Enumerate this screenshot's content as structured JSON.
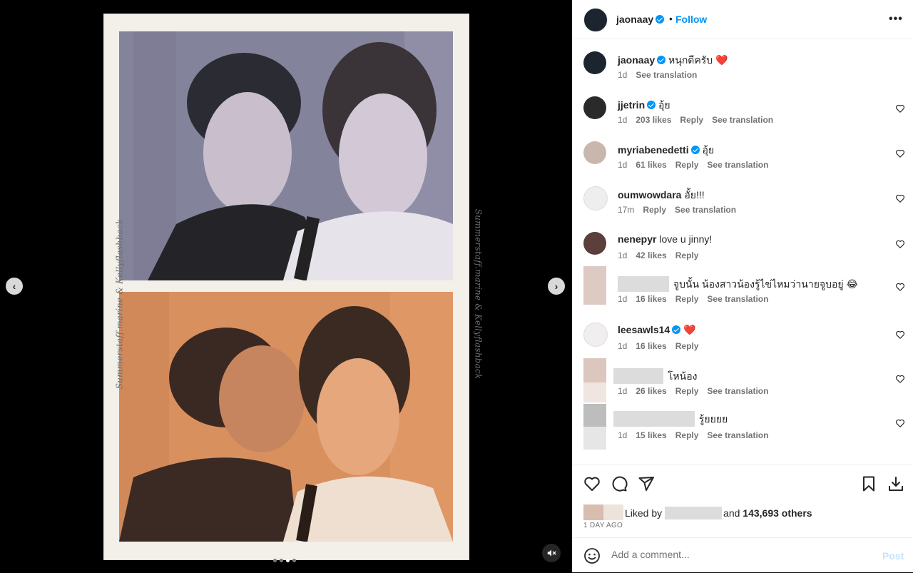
{
  "post": {
    "author": "jaonaay",
    "follow_label": "Follow",
    "separator": "•",
    "more_label": "•••",
    "caption_text": "หนุกดีครับ ❤️",
    "caption_time": "1d",
    "see_translation": "See translation"
  },
  "media": {
    "frame_caption": "Summerstaff.marine & Kellyflashback",
    "carousel_total_dots": 4,
    "carousel_active_dot": 3
  },
  "comments": [
    {
      "username": "jjetrin",
      "verified": true,
      "text": "อุ้ย",
      "time": "1d",
      "likes": "203 likes",
      "reply": "Reply",
      "translate": "See translation"
    },
    {
      "username": "myriabenedetti",
      "verified": true,
      "text": "อุ้ย",
      "time": "1d",
      "likes": "61 likes",
      "reply": "Reply",
      "translate": "See translation"
    },
    {
      "username": "oumwowdara",
      "verified": false,
      "text": "อั้ย!!!",
      "time": "17m",
      "likes": "",
      "reply": "Reply",
      "translate": "See translation"
    },
    {
      "username": "nenepyr",
      "verified": false,
      "text": "love u jinny!",
      "time": "1d",
      "likes": "42 likes",
      "reply": "Reply",
      "translate": ""
    },
    {
      "username": "",
      "verified": false,
      "text": "จูบนั้น น้องสาวน้องรู้ไข่ไหมว่านายจูบอยู่ 😂",
      "time": "1d",
      "likes": "16 likes",
      "reply": "Reply",
      "translate": "See translation"
    },
    {
      "username": "leesawls14",
      "verified": true,
      "text": "❤️",
      "time": "1d",
      "likes": "16 likes",
      "reply": "Reply",
      "translate": ""
    },
    {
      "username": "",
      "verified": false,
      "text": "โหน้อง",
      "time": "1d",
      "likes": "26 likes",
      "reply": "Reply",
      "translate": "See translation"
    },
    {
      "username": "",
      "verified": false,
      "text": "รู้ยยยย",
      "time": "1d",
      "likes": "15 likes",
      "reply": "Reply",
      "translate": "See translation"
    }
  ],
  "actions": {
    "liked_by_prefix": "Liked by",
    "liked_by_and": "and",
    "liked_by_count": "143,693 others",
    "date": "1 DAY AGO"
  },
  "comment_box": {
    "placeholder": "Add a comment...",
    "post_label": "Post"
  },
  "colors": {
    "link_blue": "#0095f6",
    "heart_red": "#ff3040",
    "muted_text": "#737373"
  }
}
